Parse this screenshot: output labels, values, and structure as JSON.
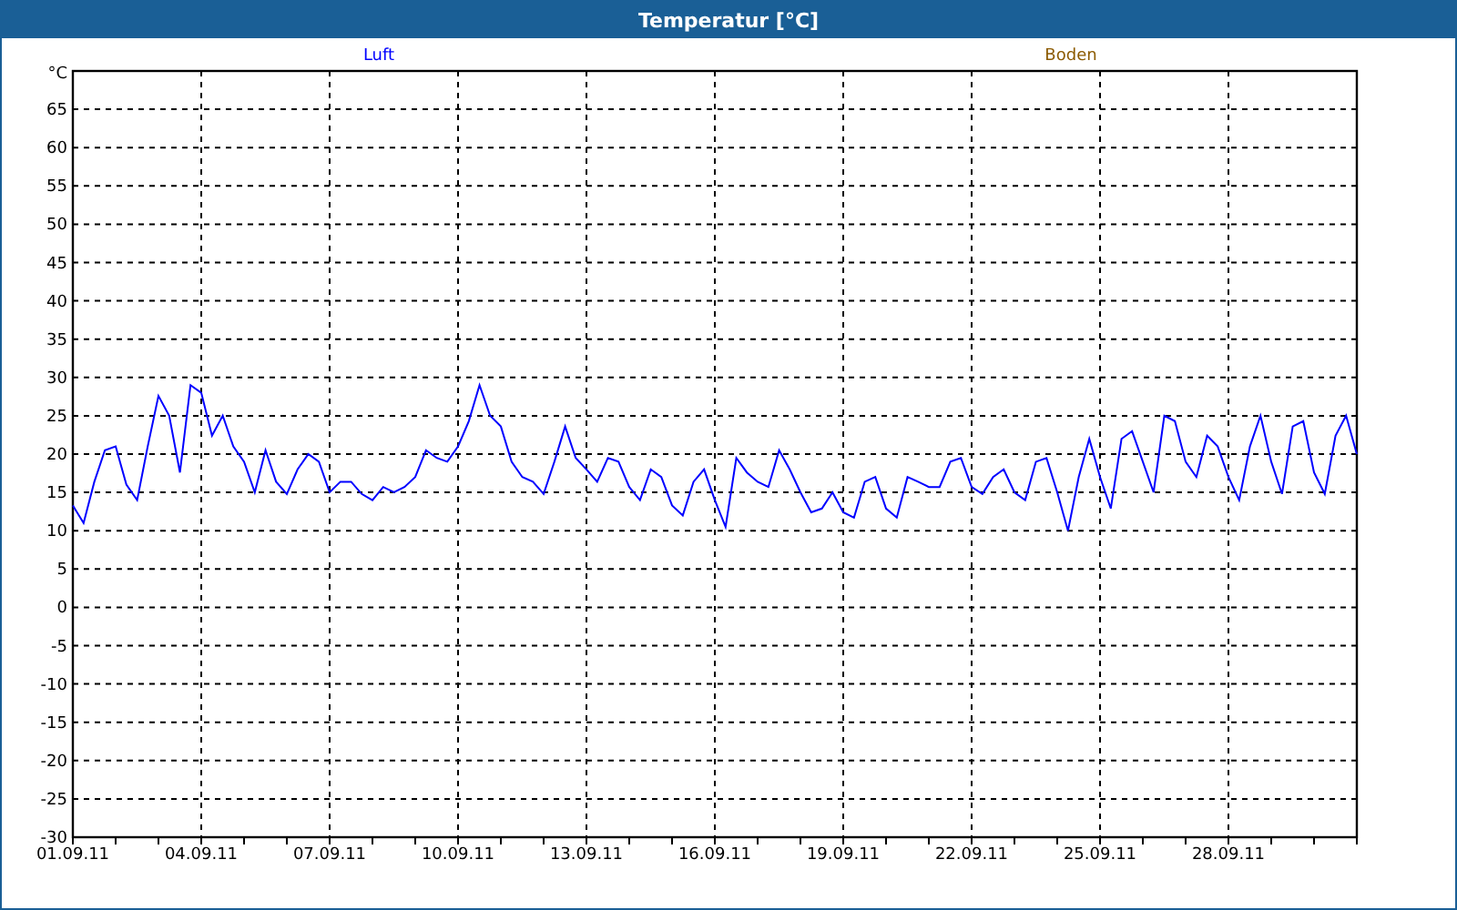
{
  "window": {
    "title": "Temperatur [°C]"
  },
  "chart": {
    "chart_data": {
      "type": "line",
      "grid": true,
      "ylabel": "°C",
      "ylim": [
        -30,
        70
      ],
      "yticks": [
        -30,
        -25,
        -20,
        -15,
        -10,
        -5,
        0,
        5,
        10,
        15,
        20,
        25,
        30,
        35,
        40,
        45,
        50,
        55,
        60,
        65
      ],
      "categories": [
        "01.09.11",
        null,
        null,
        null,
        null,
        null,
        null,
        null,
        null,
        null,
        null,
        null,
        "04.09.11",
        null,
        null,
        null,
        null,
        null,
        null,
        null,
        null,
        null,
        null,
        null,
        "07.09.11",
        null,
        null,
        null,
        null,
        null,
        null,
        null,
        null,
        null,
        null,
        null,
        "10.09.11",
        null,
        null,
        null,
        null,
        null,
        null,
        null,
        null,
        null,
        null,
        null,
        "13.09.11",
        null,
        null,
        null,
        null,
        null,
        null,
        null,
        null,
        null,
        null,
        null,
        "16.09.11",
        null,
        null,
        null,
        null,
        null,
        null,
        null,
        null,
        null,
        null,
        null,
        "19.09.11",
        null,
        null,
        null,
        null,
        null,
        null,
        null,
        null,
        null,
        null,
        null,
        "22.09.11",
        null,
        null,
        null,
        null,
        null,
        null,
        null,
        null,
        null,
        null,
        null,
        "25.09.11",
        null,
        null,
        null,
        null,
        null,
        null,
        null,
        null,
        null,
        null,
        null,
        "28.09.11",
        null,
        null,
        null,
        null,
        null,
        null,
        null,
        null,
        null,
        null,
        null,
        null
      ],
      "series": [
        {
          "name": "Luft",
          "color": "#0000ff",
          "values": [
            13.3,
            11,
            16.4,
            20.5,
            21,
            16,
            14,
            21,
            27.6,
            25,
            17.6,
            29,
            28,
            22.4,
            25,
            21,
            19,
            15,
            20.5,
            16.4,
            14.8,
            18,
            20,
            19,
            15,
            16.4,
            16.4,
            14.8,
            14,
            15.7,
            15,
            15.7,
            17,
            20.5,
            19.5,
            19,
            21,
            24.3,
            29,
            25,
            23.6,
            19,
            17,
            16.4,
            14.8,
            19,
            23.6,
            19.5,
            18,
            16.4,
            19.5,
            19,
            15.7,
            14,
            18,
            17,
            13.3,
            12,
            16.4,
            18,
            14,
            10.5,
            19.5,
            17.6,
            16.4,
            15.7,
            20.5,
            18,
            15,
            12.4,
            12.9,
            15,
            12.4,
            11.7,
            16.4,
            17,
            12.9,
            11.7,
            17,
            16.4,
            15.7,
            15.7,
            19,
            19.5,
            15.7,
            14.8,
            17,
            18,
            15,
            14,
            19,
            19.5,
            15,
            10,
            17,
            22,
            17,
            12.9,
            22,
            23,
            19,
            15,
            25,
            24.3,
            19,
            17,
            22.4,
            21,
            17,
            14,
            21,
            25,
            19,
            14.8,
            23.6,
            24.3,
            17.6,
            14.8,
            22.4,
            25,
            20
          ]
        },
        {
          "name": "Boden",
          "color": "#8b5a00",
          "values": [
            null,
            null,
            null,
            null,
            null,
            null,
            null,
            null,
            null,
            null,
            null,
            null,
            null,
            null,
            null,
            null,
            null,
            null,
            null,
            null,
            null,
            null,
            null,
            null,
            null,
            null,
            null,
            null,
            null,
            null,
            null,
            null,
            null,
            null,
            null,
            null,
            null,
            null,
            null,
            null,
            null,
            null,
            null,
            null,
            null,
            null,
            null,
            null,
            null,
            null,
            null,
            null,
            null,
            null,
            null,
            null,
            null,
            null,
            null,
            null,
            null,
            null,
            null,
            null,
            null,
            null,
            null,
            null,
            null,
            null,
            null,
            null,
            null,
            null,
            null,
            null,
            null,
            null,
            null,
            null,
            null,
            null,
            null,
            null,
            null,
            null,
            null,
            null,
            null,
            null,
            null,
            null,
            null,
            null,
            null,
            null,
            null,
            null,
            null,
            null,
            null,
            null,
            null,
            null,
            null,
            null,
            null,
            null,
            null,
            null,
            null,
            null,
            null,
            null,
            null,
            null,
            null,
            null,
            null,
            null,
            null
          ]
        }
      ]
    }
  }
}
